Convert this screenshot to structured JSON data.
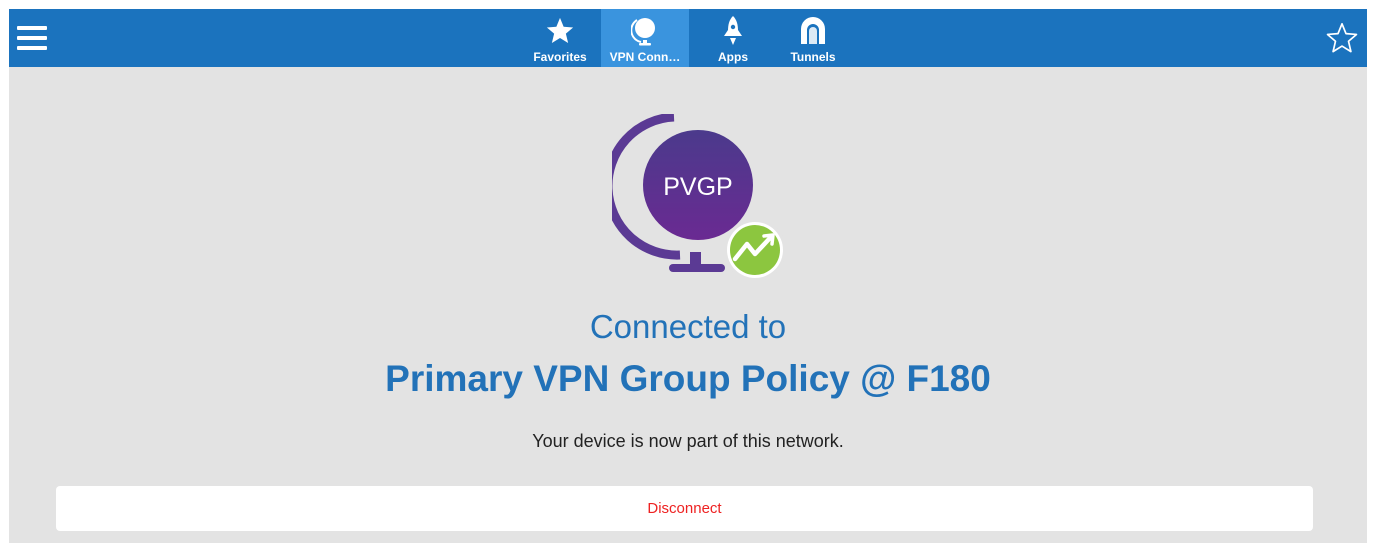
{
  "header": {
    "menu_icon": "hamburger-menu-icon",
    "favorite_icon": "star-outline-icon",
    "tabs": [
      {
        "label": "Favorites",
        "icon": "star-icon",
        "active": false
      },
      {
        "label": "VPN Conn…",
        "icon": "globe-icon",
        "active": true
      },
      {
        "label": "Apps",
        "icon": "rocket-icon",
        "active": false
      },
      {
        "label": "Tunnels",
        "icon": "tunnel-icon",
        "active": false
      }
    ]
  },
  "connection": {
    "logo_text": "PVGP",
    "logo_icon": "globe-icon",
    "badge_icon": "connection-badge-icon",
    "heading": "Connected to",
    "policy_name": "Primary VPN Group Policy @ F180",
    "message": "Your device is now part of this network.",
    "disconnect_label": "Disconnect"
  },
  "colors": {
    "header_bg": "#1b73be",
    "active_tab_bg": "#3a94de",
    "content_bg": "#e3e3e3",
    "accent_text": "#2272b8",
    "globe_purple": "#5b2d8e",
    "badge_green": "#8cc63f",
    "disconnect_text": "#ee2222"
  }
}
